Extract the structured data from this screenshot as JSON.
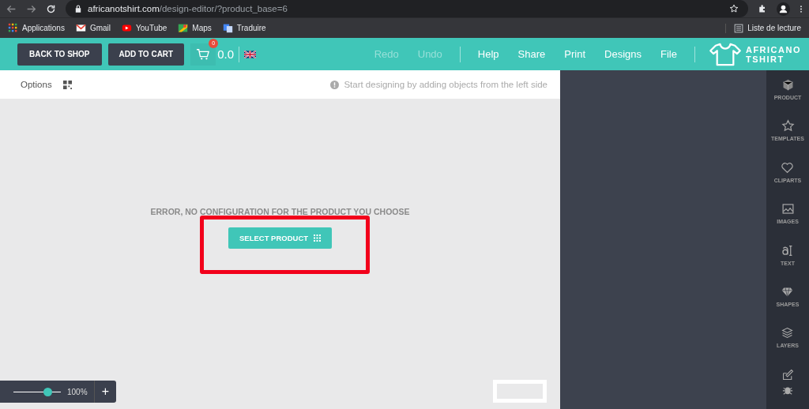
{
  "browser": {
    "url_host": "africanotshirt.com",
    "url_path": "/design-editor/?product_base=6",
    "bookmarks": [
      {
        "label": "Applications",
        "kind": "apps"
      },
      {
        "label": "Gmail",
        "kind": "mail"
      },
      {
        "label": "YouTube",
        "kind": "video"
      },
      {
        "label": "Maps",
        "kind": "map"
      },
      {
        "label": "Traduire",
        "kind": "translate"
      }
    ],
    "reading_list": "Liste de lecture"
  },
  "header": {
    "buttons": [
      "BACK TO SHOP",
      "ADD TO CART"
    ],
    "cart_count": "0",
    "cart_total": "0.0",
    "menu": [
      {
        "label": "Redo",
        "disabled": true
      },
      {
        "label": "Undo",
        "disabled": true
      },
      {
        "label": "Help",
        "disabled": false
      },
      {
        "label": "Share",
        "disabled": false
      },
      {
        "label": "Print",
        "disabled": false
      },
      {
        "label": "Designs",
        "disabled": false
      },
      {
        "label": "File",
        "disabled": false
      }
    ],
    "logo": [
      "AFRICANO",
      "TSHIRT"
    ]
  },
  "toolbar": {
    "options": "Options",
    "hint": "Start designing by adding objects from the left side"
  },
  "canvas": {
    "error": "ERROR, NO CONFIGURATION FOR THE PRODUCT YOU CHOOSE",
    "button": "SELECT PRODUCT",
    "zoom": {
      "level": 0.72,
      "reading": "100%",
      "plus": "+"
    }
  },
  "sidebar": [
    {
      "label": "PRODUCT",
      "kind": "cube"
    },
    {
      "label": "TEMPLATES",
      "kind": "star"
    },
    {
      "label": "CLIPARTS",
      "kind": "heart"
    },
    {
      "label": "IMAGES",
      "kind": "image"
    },
    {
      "label": "TEXT",
      "kind": "text"
    },
    {
      "label": "SHAPES",
      "kind": "gem"
    },
    {
      "label": "LAYERS",
      "kind": "layers"
    },
    {
      "kind": "edit"
    }
  ]
}
